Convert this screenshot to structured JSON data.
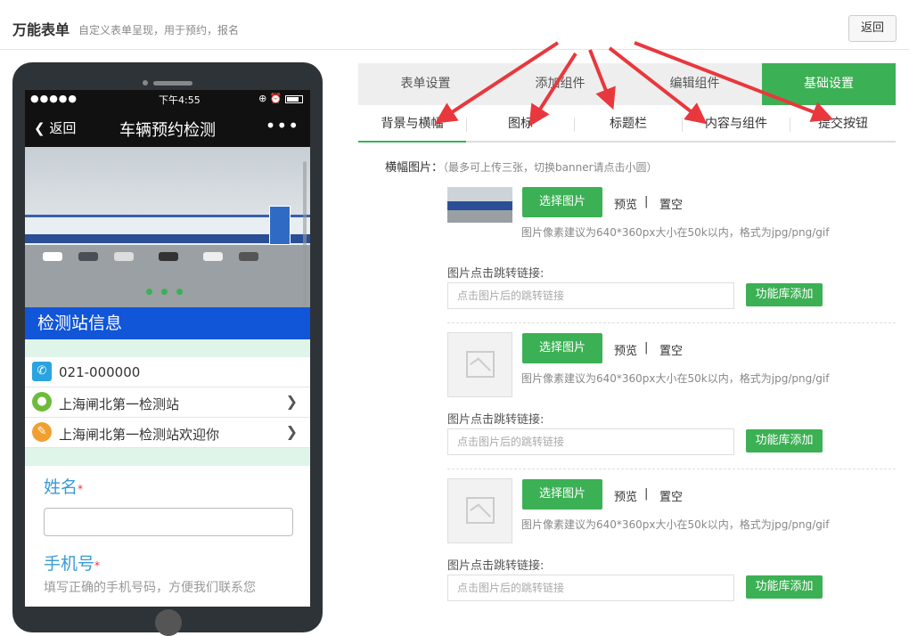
{
  "header": {
    "title": "万能表单",
    "subtitle": "自定义表单呈现，用于预约，报名",
    "back_label": "返回"
  },
  "phone": {
    "status": {
      "signal": "●●●●●",
      "time": "下午4:55"
    },
    "nav": {
      "back_label": "返回",
      "title": "车辆预约检测",
      "more": "•••"
    },
    "info_title": "检测站信息",
    "rows": [
      {
        "icon": "phone-icon",
        "text": "021-000000"
      },
      {
        "icon": "location-icon",
        "text": "上海闸北第一检测站"
      },
      {
        "icon": "pencil-icon",
        "text": "上海闸北第一检测站欢迎你"
      }
    ],
    "fields": [
      {
        "label": "姓名",
        "required": "*"
      },
      {
        "label": "手机号",
        "required": "*",
        "hint": "填写正确的手机号码，方便我们联系您"
      }
    ]
  },
  "tabs": [
    {
      "label": "表单设置",
      "active": false
    },
    {
      "label": "添加组件",
      "active": false
    },
    {
      "label": "编辑组件",
      "active": false
    },
    {
      "label": "基础设置",
      "active": true
    }
  ],
  "subtabs": [
    {
      "label": "背景与横幅",
      "active": true
    },
    {
      "label": "图标",
      "active": false
    },
    {
      "label": "标题栏",
      "active": false
    },
    {
      "label": "内容与组件",
      "active": false
    },
    {
      "label": "提交按钮",
      "active": false
    }
  ],
  "banner_section": {
    "label": "横幅图片：",
    "hint": "（最多可上传三张，切换banner请点击小圆）",
    "choose_label": "选择图片",
    "preview_label": "预览",
    "separator": "|",
    "clear_label": "置空",
    "size_tip": "图片像素建议为640*360px大小在50k以内，格式为jpg/png/gif",
    "link_label": "图片点击跳转链接:",
    "link_placeholder": "点击图片后的跳转链接",
    "lib_add_label": "功能库添加"
  },
  "colors": {
    "accent_green": "#3cb054",
    "info_blue": "#1155d8",
    "arrow_red": "#e8383d"
  }
}
